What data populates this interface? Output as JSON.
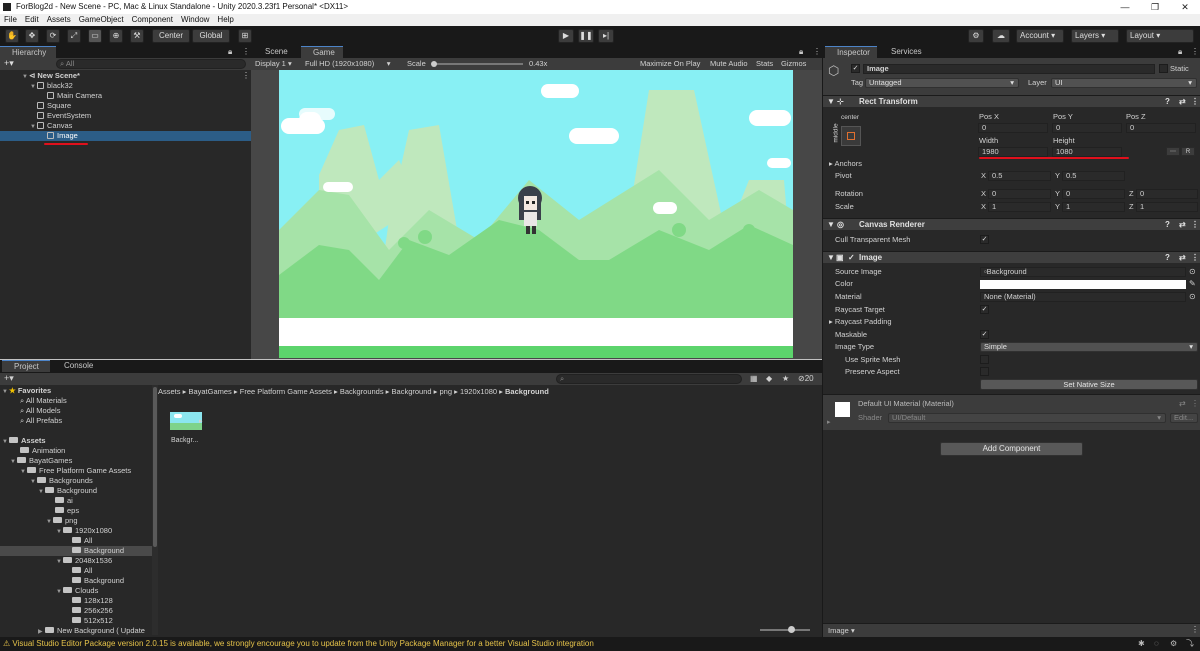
{
  "window": {
    "title": "ForBlog2d - New Scene - PC, Mac & Linux Standalone - Unity 2020.3.23f1 Personal* <DX11>"
  },
  "menu": [
    "File",
    "Edit",
    "Assets",
    "GameObject",
    "Component",
    "Window",
    "Help"
  ],
  "toolbar": {
    "center_label": "Center",
    "global_label": "Global",
    "account_label": "Account",
    "layers_label": "Layers",
    "layout_label": "Layout"
  },
  "hierarchy": {
    "tab": "Hierarchy",
    "search_placeholder": "All",
    "items": [
      {
        "label": "New Scene*",
        "depth": 0,
        "bold": true
      },
      {
        "label": "black32",
        "depth": 1
      },
      {
        "label": "Main Camera",
        "depth": 2
      },
      {
        "label": "Square",
        "depth": 1
      },
      {
        "label": "EventSystem",
        "depth": 1
      },
      {
        "label": "Canvas",
        "depth": 1
      },
      {
        "label": "Image",
        "depth": 2,
        "selected": true
      }
    ]
  },
  "game_view": {
    "tabs": [
      "Scene",
      "Game"
    ],
    "display": "Display 1",
    "resolution": "Full HD (1920x1080)",
    "scale_label": "Scale",
    "scale_value": "0.43x",
    "buttons": [
      "Maximize On Play",
      "Mute Audio",
      "Stats",
      "Gizmos"
    ]
  },
  "project": {
    "tabs": [
      "Project",
      "Console"
    ],
    "favorites_label": "Favorites",
    "favorites": [
      "All Materials",
      "All Models",
      "All Prefabs"
    ],
    "assets_label": "Assets",
    "tree": [
      {
        "label": "Animation",
        "depth": 1
      },
      {
        "label": "BayatGames",
        "depth": 1
      },
      {
        "label": "Free Platform Game Assets",
        "depth": 2
      },
      {
        "label": "Backgrounds",
        "depth": 3
      },
      {
        "label": "Background",
        "depth": 4
      },
      {
        "label": "ai",
        "depth": 5
      },
      {
        "label": "eps",
        "depth": 5
      },
      {
        "label": "png",
        "depth": 5
      },
      {
        "label": "1920x1080",
        "depth": 6
      },
      {
        "label": "All",
        "depth": 7
      },
      {
        "label": "Background",
        "depth": 7,
        "selected": true
      },
      {
        "label": "2048x1536",
        "depth": 6
      },
      {
        "label": "All",
        "depth": 7
      },
      {
        "label": "Background",
        "depth": 7
      },
      {
        "label": "Clouds",
        "depth": 6
      },
      {
        "label": "128x128",
        "depth": 7
      },
      {
        "label": "256x256",
        "depth": 7
      },
      {
        "label": "512x512",
        "depth": 7
      },
      {
        "label": "New Background ( Update",
        "depth": 4
      }
    ],
    "breadcrumb": [
      "Assets",
      "BayatGames",
      "Free Platform Game Assets",
      "Backgrounds",
      "Background",
      "png",
      "1920x1080",
      "Background"
    ],
    "hidden_count": "20",
    "asset_label": "Backgr..."
  },
  "inspector": {
    "tabs": [
      "Inspector",
      "Services"
    ],
    "object_name": "Image",
    "static_label": "Static",
    "tag_label": "Tag",
    "tag_value": "Untagged",
    "layer_label": "Layer",
    "layer_value": "UI",
    "rect_transform": {
      "title": "Rect Transform",
      "anchor_h": "center",
      "anchor_v": "middle",
      "posx_label": "Pos X",
      "posx": "0",
      "posy_label": "Pos Y",
      "posy": "0",
      "posz_label": "Pos Z",
      "posz": "0",
      "width_label": "Width",
      "width": "1980",
      "height_label": "Height",
      "height": "1080",
      "anchors_label": "Anchors",
      "pivot_label": "Pivot",
      "pivot_x": "0.5",
      "pivot_y": "0.5",
      "rotation_label": "Rotation",
      "rot_x": "0",
      "rot_y": "0",
      "rot_z": "0",
      "scale_label": "Scale",
      "scale_x": "1",
      "scale_y": "1",
      "scale_z": "1",
      "r_button": "R"
    },
    "canvas_renderer": {
      "title": "Canvas Renderer",
      "cull_label": "Cull Transparent Mesh"
    },
    "image": {
      "title": "Image",
      "source_label": "Source Image",
      "source_value": "Background",
      "color_label": "Color",
      "material_label": "Material",
      "material_value": "None (Material)",
      "raycast_target_label": "Raycast Target",
      "raycast_padding_label": "Raycast Padding",
      "maskable_label": "Maskable",
      "image_type_label": "Image Type",
      "image_type_value": "Simple",
      "use_sprite_mesh_label": "Use Sprite Mesh",
      "preserve_aspect_label": "Preserve Aspect",
      "set_native_size": "Set Native Size"
    },
    "material": {
      "title": "Default UI Material (Material)",
      "shader_label": "Shader",
      "shader_value": "UI/Default",
      "edit_label": "Edit..."
    },
    "add_component": "Add Component",
    "preview_label": "Image"
  },
  "status_bar": {
    "message": "Visual Studio Editor Package version 2.0.15 is available, we strongly encourage you to update from the Unity Package Manager for a better Visual Studio integration"
  },
  "colors": {
    "sky": "#88f0f4",
    "grass": "#5cd46c",
    "selection": "#2c5d87",
    "annotation": "#e0101c"
  }
}
